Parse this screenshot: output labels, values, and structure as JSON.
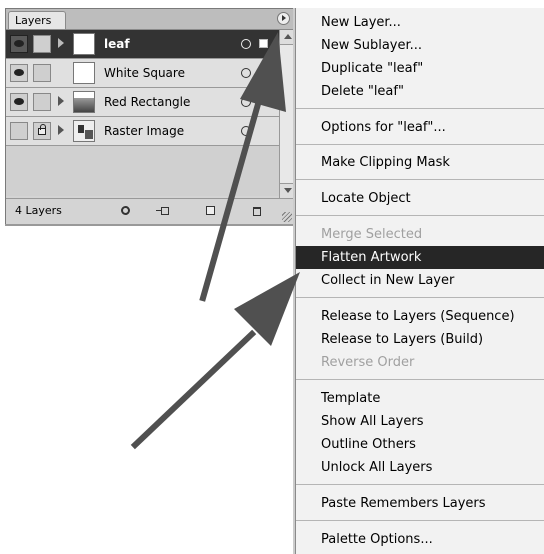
{
  "palette": {
    "tab_label": "Layers",
    "layers": [
      {
        "name": "leaf",
        "selected": true,
        "visible": true,
        "locked": false,
        "thumb": "white"
      },
      {
        "name": "White Square",
        "selected": false,
        "visible": true,
        "locked": false,
        "thumb": "white"
      },
      {
        "name": "Red Rectangle",
        "selected": false,
        "visible": true,
        "locked": false,
        "thumb": "red"
      },
      {
        "name": "Raster Image",
        "selected": false,
        "visible": false,
        "locked": true,
        "thumb": "raster"
      }
    ],
    "layer_count": "4 Layers",
    "icons": [
      "eye-icon",
      "lock-icon",
      "expand-triangle-icon",
      "target-circle-icon",
      "locate-object-icon",
      "make-sublayer-icon",
      "new-layer-icon",
      "trash-icon",
      "palette-menu-icon",
      "resize-grip-icon"
    ]
  },
  "menu": {
    "items": [
      {
        "label": "New Layer...",
        "state": "enabled"
      },
      {
        "label": "New Sublayer...",
        "state": "enabled"
      },
      {
        "label": "Duplicate \"leaf\"",
        "state": "enabled"
      },
      {
        "label": "Delete \"leaf\"",
        "state": "enabled"
      },
      {
        "label": "Options for \"leaf\"...",
        "state": "enabled"
      },
      {
        "label": "Make Clipping Mask",
        "state": "enabled"
      },
      {
        "label": "Locate Object",
        "state": "enabled"
      },
      {
        "label": "Merge Selected",
        "state": "disabled"
      },
      {
        "label": "Flatten Artwork",
        "state": "highlighted"
      },
      {
        "label": "Collect in New Layer",
        "state": "enabled"
      },
      {
        "label": "Release to Layers (Sequence)",
        "state": "enabled"
      },
      {
        "label": "Release to Layers (Build)",
        "state": "enabled"
      },
      {
        "label": "Reverse Order",
        "state": "disabled"
      },
      {
        "label": "Template",
        "state": "enabled"
      },
      {
        "label": "Show All Layers",
        "state": "enabled"
      },
      {
        "label": "Outline Others",
        "state": "enabled"
      },
      {
        "label": "Unlock All Layers",
        "state": "enabled"
      },
      {
        "label": "Paste Remembers Layers",
        "state": "enabled"
      },
      {
        "label": "Palette Options...",
        "state": "enabled"
      }
    ]
  },
  "colors": {
    "highlight": "#262626",
    "arrow": "#505050",
    "disabled_text": "#a0a0a0"
  }
}
